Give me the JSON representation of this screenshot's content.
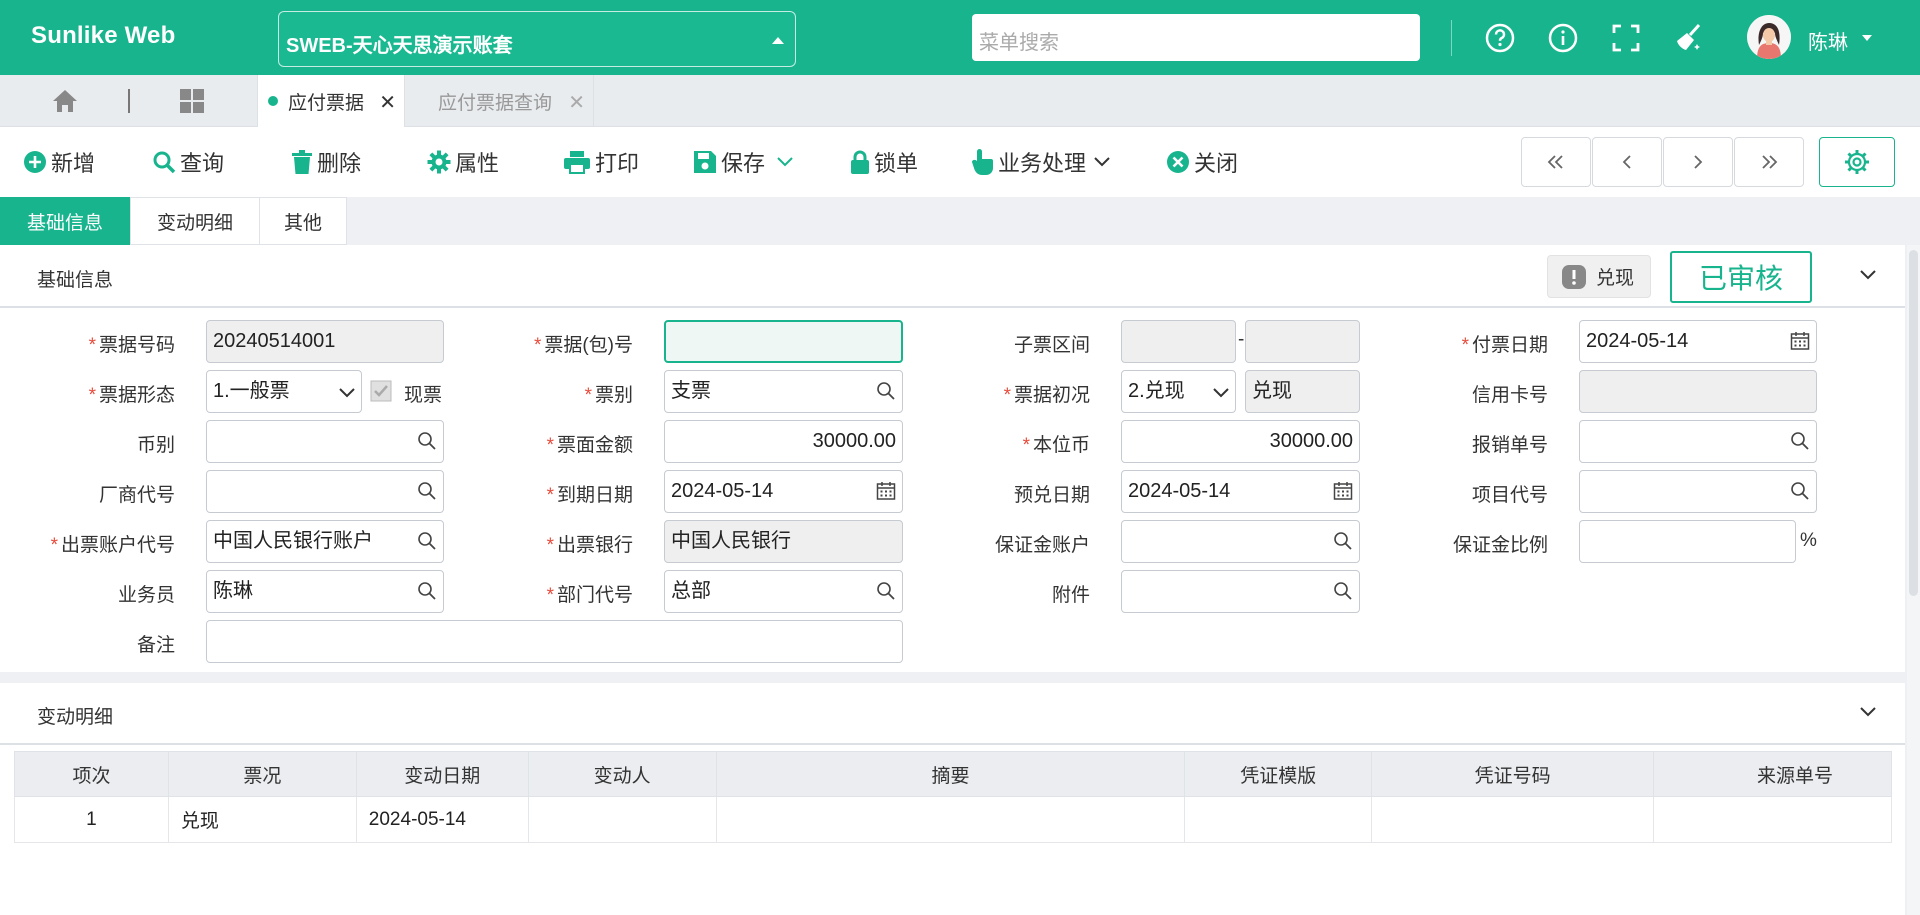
{
  "app": {
    "brand": "Sunlike Web",
    "account": "SWEB-天心天思演示账套",
    "search_placeholder": "菜单搜索",
    "user": "陈琳",
    "accent": "#18b48e"
  },
  "page_tabs": [
    {
      "label": "应付票据",
      "active": true
    },
    {
      "label": "应付票据查询",
      "active": false
    }
  ],
  "toolbar": {
    "new": "新增",
    "query": "查询",
    "delete": "删除",
    "properties": "属性",
    "print": "打印",
    "save": "保存",
    "lock": "锁单",
    "business": "业务处理",
    "close": "关闭"
  },
  "section_tabs": [
    "基础信息",
    "变动明细",
    "其他"
  ],
  "basic": {
    "title": "基础信息",
    "badge": "兑现",
    "audit": "已审核",
    "labels": {
      "bill_no": "票据号码",
      "package_no": "票据(包)号",
      "sub_range": "子票区间",
      "pay_date": "付票日期",
      "form": "票据形态",
      "instant": "现票",
      "bill_type": "票别",
      "initial": "票据初况",
      "card_no": "信用卡号",
      "currency": "币别",
      "face_amount": "票面金额",
      "local_amount": "本位币",
      "expense_no": "报销单号",
      "vendor": "厂商代号",
      "due_date": "到期日期",
      "expect_date": "预兑日期",
      "project": "项目代号",
      "issue_account": "出票账户代号",
      "issue_bank": "出票银行",
      "deposit_account": "保证金账户",
      "deposit_ratio": "保证金比例",
      "salesman": "业务员",
      "dept": "部门代号",
      "attachment": "附件",
      "remark": "备注"
    },
    "values": {
      "bill_no": "20240514001",
      "package_no": "",
      "sub_from": "",
      "sub_to": "",
      "sub_sep": "-",
      "pay_date": "2024-05-14",
      "form": "1.一般票",
      "bill_type": "支票",
      "initial_code": "2.兑现",
      "initial_text": "兑现",
      "card_no": "",
      "currency": "",
      "face_amount": "30000.00",
      "local_amount": "30000.00",
      "expense_no": "",
      "vendor": "",
      "due_date": "2024-05-14",
      "expect_date": "2024-05-14",
      "project": "",
      "issue_account": "中国人民银行账户",
      "issue_bank": "中国人民银行",
      "deposit_account": "",
      "deposit_ratio": "",
      "percent": "%",
      "salesman": "陈琳",
      "dept": "总部",
      "attachment": "",
      "remark": ""
    }
  },
  "change": {
    "title": "变动明细",
    "columns": [
      "项次",
      "票况",
      "变动日期",
      "变动人",
      "摘要",
      "凭证模版",
      "凭证号码",
      "来源单号"
    ],
    "rows": [
      [
        "1",
        "兑现",
        "2024-05-14",
        "",
        "",
        "",
        "",
        ""
      ]
    ]
  }
}
